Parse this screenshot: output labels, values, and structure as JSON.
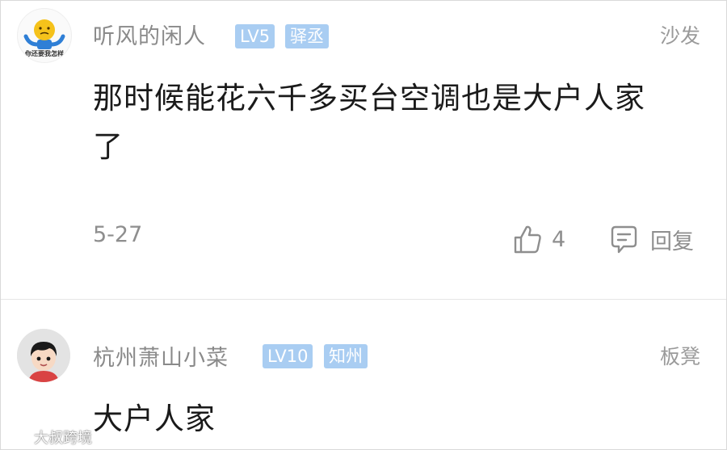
{
  "comments": [
    {
      "username": "听风的闲人",
      "level": "LV5",
      "title": "驿丞",
      "floor": "沙发",
      "text": "那时候能花六千多买台空调也是大户人家了",
      "date": "5-27",
      "likes": "4",
      "reply_label": "回复",
      "avatar_caption": "你还要我怎样"
    },
    {
      "username": "杭州萧山小菜",
      "level": "LV10",
      "title": "知州",
      "floor": "板凳",
      "text": "大户人家"
    }
  ],
  "watermark": {
    "text": "大叔跨境"
  },
  "colors": {
    "badge": "#a9cdf2",
    "meta_text": "#8e8e8e",
    "body_text": "#1a1a1a"
  }
}
